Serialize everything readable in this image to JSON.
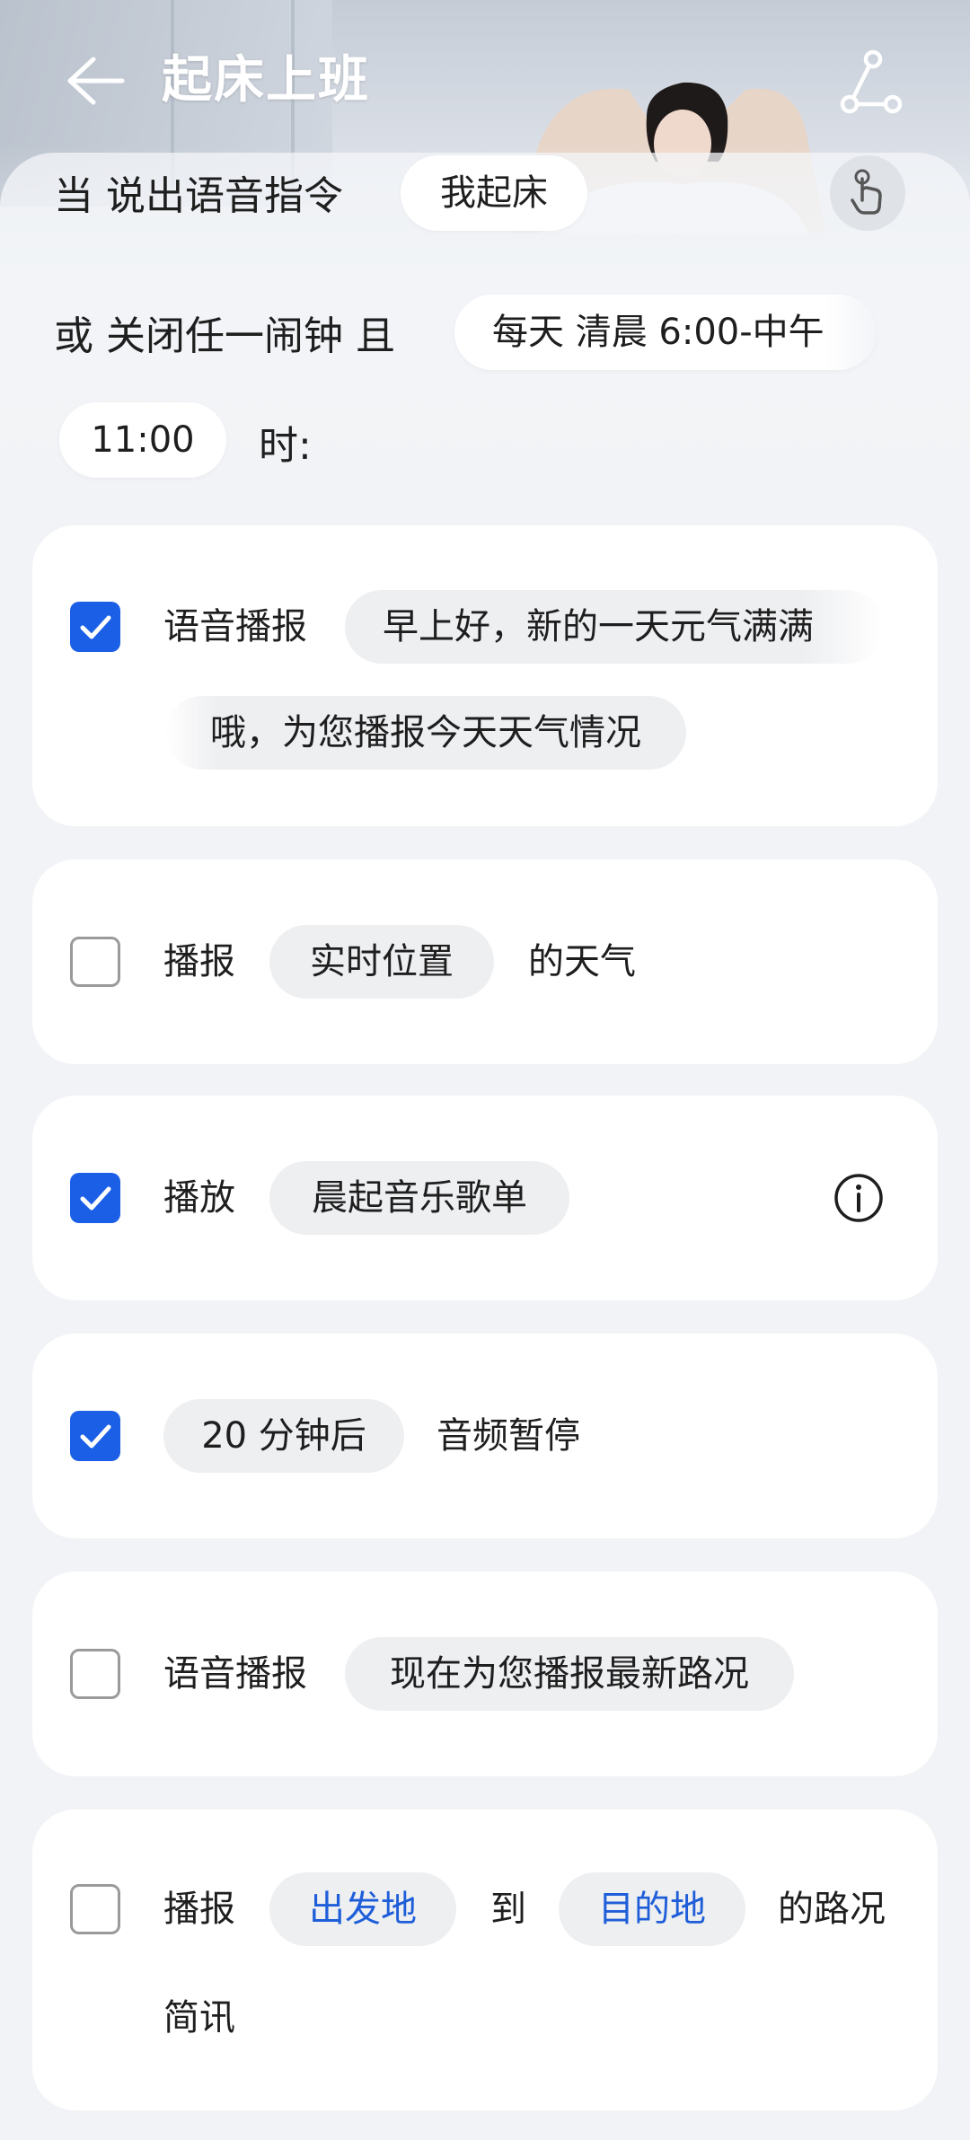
{
  "header": {
    "title": "起床上班"
  },
  "trigger": {
    "line1_prefix": "当 说出语音指令",
    "voice_command": "我起床",
    "line2_prefix": "或 关闭任一闹钟 且",
    "time_range": "每天 清晨 6:00-中午",
    "time_end": "11:00",
    "time_suffix": "时:"
  },
  "actions": [
    {
      "checked": true,
      "label": "语音播报",
      "text_line1": "早上好，新的一天元气满满",
      "text_line2": "哦，为您播报今天天气情况"
    },
    {
      "checked": false,
      "label": "播报",
      "value": "实时位置",
      "suffix": "的天气"
    },
    {
      "checked": true,
      "label": "播放",
      "value": "晨起音乐歌单"
    },
    {
      "checked": true,
      "value": "20 分钟后",
      "suffix": "音频暂停"
    },
    {
      "checked": false,
      "label": "语音播报",
      "value": "现在为您播报最新路况"
    },
    {
      "checked": false,
      "label": "播报",
      "from": "出发地",
      "mid": "到",
      "to": "目的地",
      "suffix": "的路况",
      "line2": "简讯"
    }
  ],
  "colors": {
    "accent": "#1a5fe6",
    "link": "#1f5ed9",
    "card": "#ffffff",
    "background": "#f1f3f6"
  }
}
